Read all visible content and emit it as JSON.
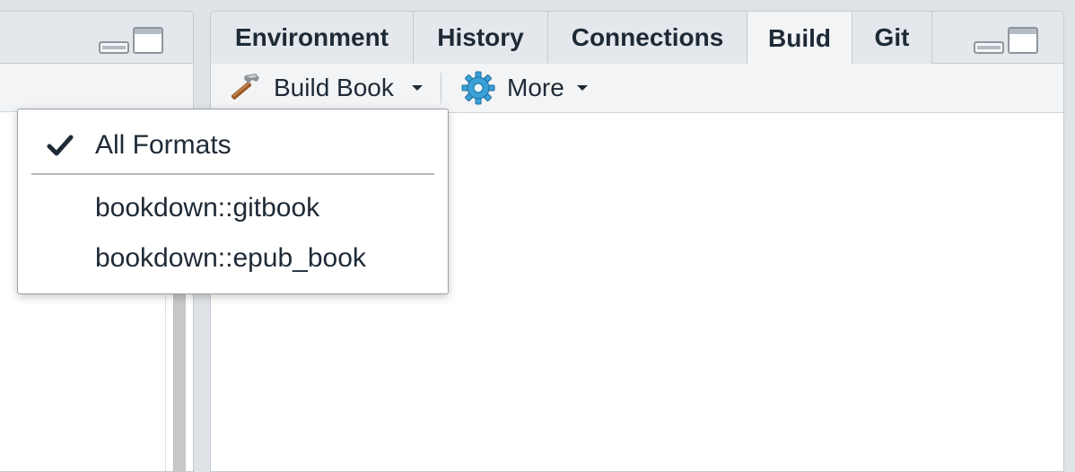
{
  "tabs": [
    {
      "label": "Environment",
      "active": false
    },
    {
      "label": "History",
      "active": false
    },
    {
      "label": "Connections",
      "active": false
    },
    {
      "label": "Build",
      "active": true
    },
    {
      "label": "Git",
      "active": false
    }
  ],
  "toolbar": {
    "build_book_label": "Build Book",
    "more_label": "More"
  },
  "menu": {
    "items": [
      {
        "label": "All Formats",
        "checked": true
      },
      {
        "label": "bookdown::gitbook",
        "checked": false
      },
      {
        "label": "bookdown::epub_book",
        "checked": false
      }
    ]
  },
  "icons": {
    "build": "hammer-icon",
    "more": "gear-icon",
    "check": "checkmark-icon"
  },
  "colors": {
    "text": "#1e2a36",
    "tab_strip": "#e4e8ec",
    "toolbar": "#f2f4f6",
    "gear": "#3aa0d8"
  }
}
